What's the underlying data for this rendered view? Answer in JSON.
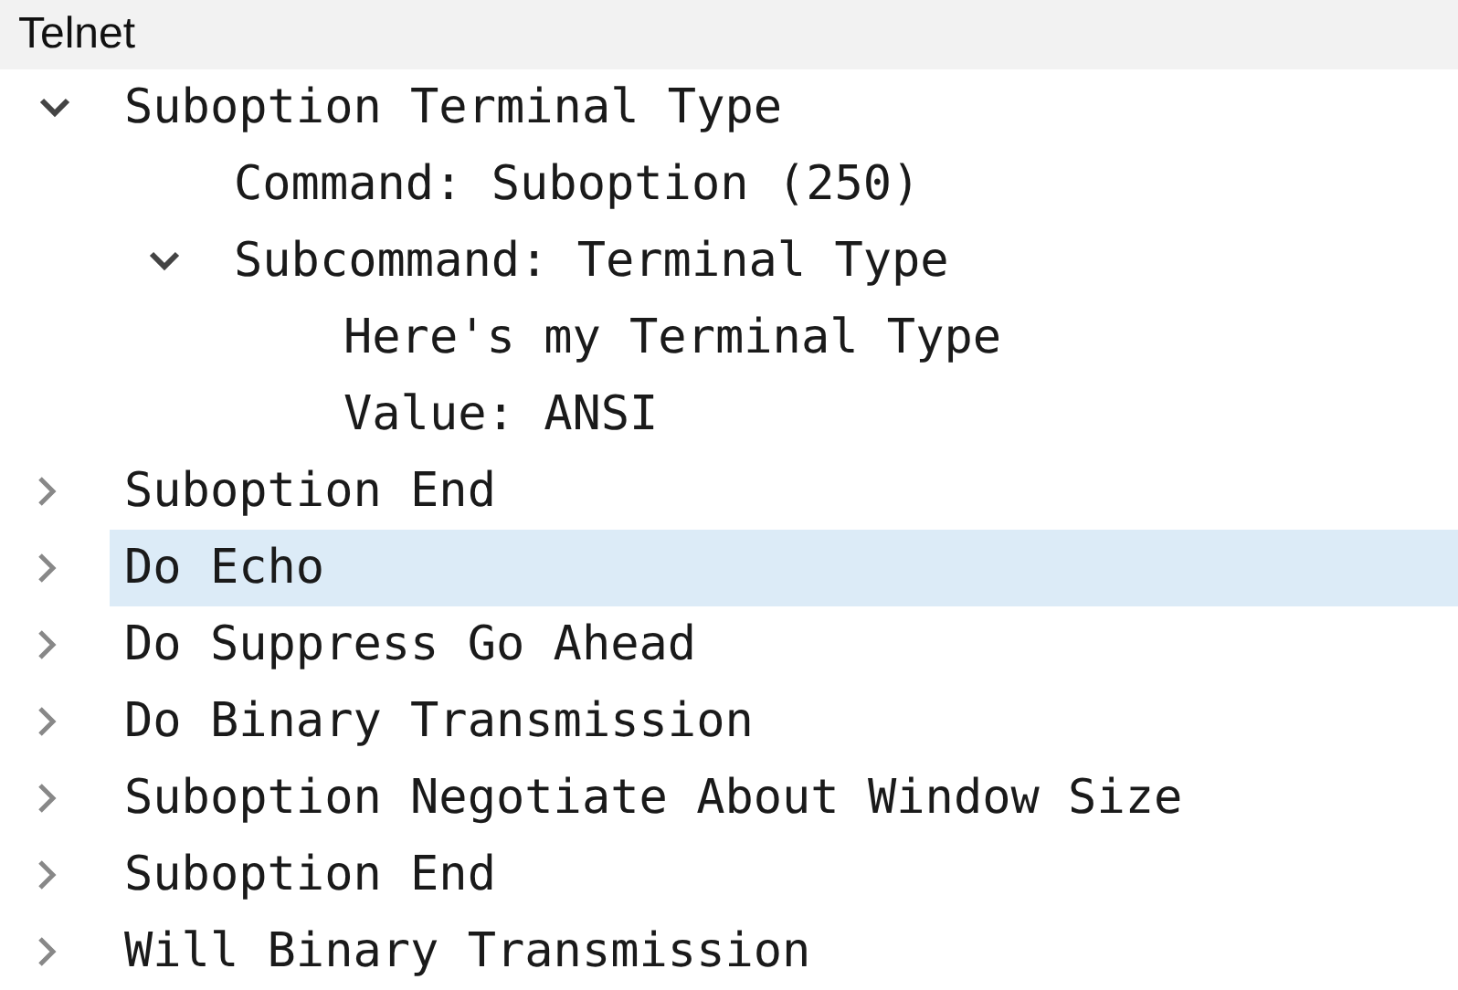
{
  "header": {
    "title": "Telnet"
  },
  "tree": [
    {
      "label": "Suboption Terminal Type",
      "expanded": true,
      "selected": false,
      "children": [
        {
          "label": "Command: Suboption (250)",
          "selected": false
        },
        {
          "label": "Subcommand: Terminal Type",
          "expanded": true,
          "selected": false,
          "children": [
            {
              "label": "Here's my Terminal Type",
              "selected": false
            },
            {
              "label": "Value: ANSI",
              "selected": false
            }
          ]
        }
      ]
    },
    {
      "label": "Suboption End",
      "expanded": false,
      "selected": false
    },
    {
      "label": "Do Echo",
      "expanded": false,
      "selected": true
    },
    {
      "label": "Do Suppress Go Ahead",
      "expanded": false,
      "selected": false
    },
    {
      "label": "Do Binary Transmission",
      "expanded": false,
      "selected": false
    },
    {
      "label": "Suboption Negotiate About Window Size",
      "expanded": false,
      "selected": false
    },
    {
      "label": "Suboption End",
      "expanded": false,
      "selected": false
    },
    {
      "label": "Will Binary Transmission",
      "expanded": false,
      "selected": false
    }
  ]
}
